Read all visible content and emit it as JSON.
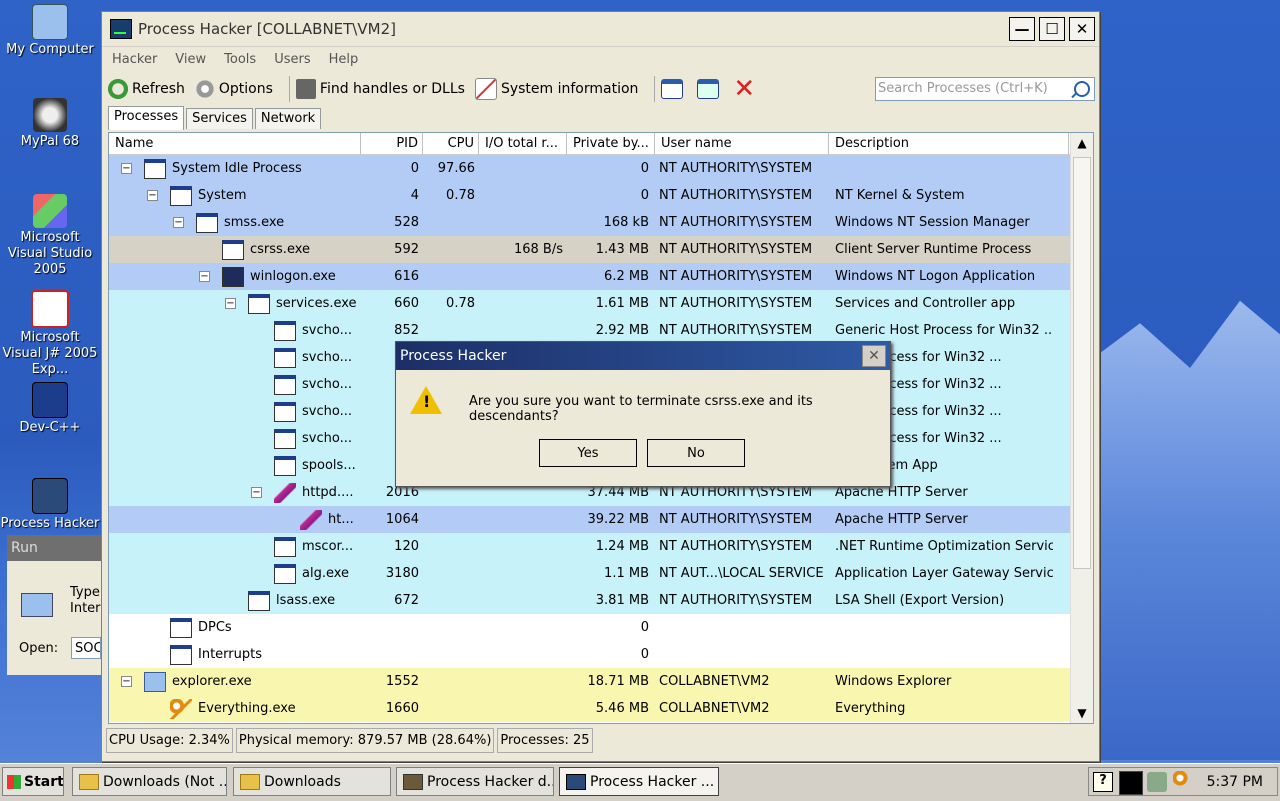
{
  "desktop": {
    "icons": [
      {
        "label": "My Computer"
      },
      {
        "label": "MyPal 68"
      },
      {
        "label": "Microsoft Visual Studio 2005"
      },
      {
        "label": "Microsoft Visual J# 2005 Exp..."
      },
      {
        "label": "Dev-C++"
      },
      {
        "label": "Process Hacker"
      }
    ]
  },
  "window": {
    "title": "Process Hacker [COLLABNET\\VM2]",
    "min": "—",
    "max": "☐",
    "close": "✕"
  },
  "menu": [
    "Hacker",
    "View",
    "Tools",
    "Users",
    "Help"
  ],
  "toolbar": {
    "refresh": "Refresh",
    "options": "Options",
    "find": "Find handles or DLLs",
    "sysinfo": "System information",
    "search_placeholder": "Search Processes (Ctrl+K)"
  },
  "tabs": [
    "Processes",
    "Services",
    "Network"
  ],
  "columns": [
    "Name",
    "PID",
    "CPU",
    "I/O total r...",
    "Private by...",
    "User name",
    "Description"
  ],
  "rows": [
    {
      "indent": 0,
      "exp": "−",
      "name": "System Idle Process",
      "pid": "0",
      "cpu": "97.66",
      "io": "",
      "priv": "0",
      "user": "NT AUTHORITY\\SYSTEM",
      "desc": "",
      "bg": "#b3ccf5",
      "icon": "window"
    },
    {
      "indent": 1,
      "exp": "−",
      "name": "System",
      "pid": "4",
      "cpu": "0.78",
      "io": "",
      "priv": "0",
      "user": "NT AUTHORITY\\SYSTEM",
      "desc": "NT Kernel & System",
      "bg": "#b3ccf5",
      "icon": "window"
    },
    {
      "indent": 2,
      "exp": "−",
      "name": "smss.exe",
      "pid": "528",
      "cpu": "",
      "io": "",
      "priv": "168 kB",
      "user": "NT AUTHORITY\\SYSTEM",
      "desc": "Windows NT Session Manager",
      "bg": "#b3ccf5",
      "icon": "window"
    },
    {
      "indent": 3,
      "exp": "",
      "name": "csrss.exe",
      "pid": "592",
      "cpu": "",
      "io": "168 B/s",
      "priv": "1.43 MB",
      "user": "NT AUTHORITY\\SYSTEM",
      "desc": "Client Server Runtime Process",
      "bg": "#d6d2c6",
      "icon": "window"
    },
    {
      "indent": 3,
      "exp": "−",
      "name": "winlogon.exe",
      "pid": "616",
      "cpu": "",
      "io": "",
      "priv": "6.2 MB",
      "user": "NT AUTHORITY\\SYSTEM",
      "desc": "Windows NT Logon Application",
      "bg": "#b3ccf5",
      "icon": "winlogon"
    },
    {
      "indent": 4,
      "exp": "−",
      "name": "services.exe",
      "pid": "660",
      "cpu": "0.78",
      "io": "",
      "priv": "1.61 MB",
      "user": "NT AUTHORITY\\SYSTEM",
      "desc": "Services and Controller app",
      "bg": "#c7f2fa",
      "icon": "window"
    },
    {
      "indent": 5,
      "exp": "",
      "name": "svcho...",
      "pid": "852",
      "cpu": "",
      "io": "",
      "priv": "2.92 MB",
      "user": "NT AUTHORITY\\SYSTEM",
      "desc": "Generic Host Process for Win32 ...",
      "bg": "#c7f2fa",
      "icon": "window"
    },
    {
      "indent": 5,
      "exp": "",
      "name": "svcho...",
      "pid": "",
      "cpu": "",
      "io": "",
      "priv": "",
      "user": "",
      "desc": "Host Process for Win32 ...",
      "bg": "#c7f2fa",
      "icon": "window"
    },
    {
      "indent": 5,
      "exp": "",
      "name": "svcho...",
      "pid": "1(",
      "cpu": "",
      "io": "",
      "priv": "",
      "user": "",
      "desc": "Host Process for Win32 ...",
      "bg": "#c7f2fa",
      "icon": "window"
    },
    {
      "indent": 5,
      "exp": "",
      "name": "svcho...",
      "pid": "1",
      "cpu": "",
      "io": "",
      "priv": "",
      "user": "",
      "desc": "Host Process for Win32 ...",
      "bg": "#c7f2fa",
      "icon": "window"
    },
    {
      "indent": 5,
      "exp": "",
      "name": "svcho...",
      "pid": "1",
      "cpu": "",
      "io": "",
      "priv": "",
      "user": "",
      "desc": "Host Process for Win32 ...",
      "bg": "#c7f2fa",
      "icon": "window"
    },
    {
      "indent": 5,
      "exp": "",
      "name": "spools...",
      "pid": "1",
      "cpu": "",
      "io": "",
      "priv": "",
      "user": "",
      "desc": "SubSystem App",
      "bg": "#c7f2fa",
      "icon": "window"
    },
    {
      "indent": 5,
      "exp": "−",
      "name": "httpd....",
      "pid": "2016",
      "cpu": "",
      "io": "",
      "priv": "37.44 MB",
      "user": "NT AUTHORITY\\SYSTEM",
      "desc": "Apache HTTP Server",
      "bg": "#c7f2fa",
      "icon": "feather"
    },
    {
      "indent": 6,
      "exp": "",
      "name": "ht...",
      "pid": "1064",
      "cpu": "",
      "io": "",
      "priv": "39.22 MB",
      "user": "NT AUTHORITY\\SYSTEM",
      "desc": "Apache HTTP Server",
      "bg": "#b3ccf5",
      "icon": "feather"
    },
    {
      "indent": 5,
      "exp": "",
      "name": "mscor...",
      "pid": "120",
      "cpu": "",
      "io": "",
      "priv": "1.24 MB",
      "user": "NT AUTHORITY\\SYSTEM",
      "desc": ".NET Runtime Optimization Service",
      "bg": "#c7f2fa",
      "icon": "window"
    },
    {
      "indent": 5,
      "exp": "",
      "name": "alg.exe",
      "pid": "3180",
      "cpu": "",
      "io": "",
      "priv": "1.1 MB",
      "user": "NT AUT...\\LOCAL SERVICE",
      "desc": "Application Layer Gateway Service",
      "bg": "#c7f2fa",
      "icon": "window"
    },
    {
      "indent": 4,
      "exp": "",
      "name": "lsass.exe",
      "pid": "672",
      "cpu": "",
      "io": "",
      "priv": "3.81 MB",
      "user": "NT AUTHORITY\\SYSTEM",
      "desc": "LSA Shell (Export Version)",
      "bg": "#c7f2fa",
      "icon": "window"
    },
    {
      "indent": 1,
      "exp": "",
      "name": "DPCs",
      "pid": "",
      "cpu": "",
      "io": "",
      "priv": "0",
      "user": "",
      "desc": "",
      "bg": "#ffffff",
      "icon": "window"
    },
    {
      "indent": 1,
      "exp": "",
      "name": "Interrupts",
      "pid": "",
      "cpu": "",
      "io": "",
      "priv": "0",
      "user": "",
      "desc": "",
      "bg": "#ffffff",
      "icon": "window"
    },
    {
      "indent": 0,
      "exp": "−",
      "name": "explorer.exe",
      "pid": "1552",
      "cpu": "",
      "io": "",
      "priv": "18.71 MB",
      "user": "COLLABNET\\VM2",
      "desc": "Windows Explorer",
      "bg": "#f9f6b0",
      "icon": "comp"
    },
    {
      "indent": 1,
      "exp": "",
      "name": "Everything.exe",
      "pid": "1660",
      "cpu": "",
      "io": "",
      "priv": "5.46 MB",
      "user": "COLLABNET\\VM2",
      "desc": "Everything",
      "bg": "#f9f6b0",
      "icon": "key"
    }
  ],
  "status": {
    "cpu": "CPU Usage: 2.34%",
    "mem": "Physical memory: 879.57 MB (28.64%)",
    "procs": "Processes: 25"
  },
  "dialog": {
    "title": "Process Hacker",
    "close": "✕",
    "message": "Are you sure you want to terminate csrss.exe and its descendants?",
    "yes": "Yes",
    "no": "No"
  },
  "run": {
    "title": "Run",
    "type": "Type",
    "inter": "Interr",
    "open": "Open:",
    "value": "SOC"
  },
  "taskbar": {
    "start": "Start",
    "items": [
      "Downloads (Not ...",
      "Downloads",
      "Process Hacker d...",
      "Process Hacker ..."
    ],
    "clock": "5:37 PM"
  }
}
